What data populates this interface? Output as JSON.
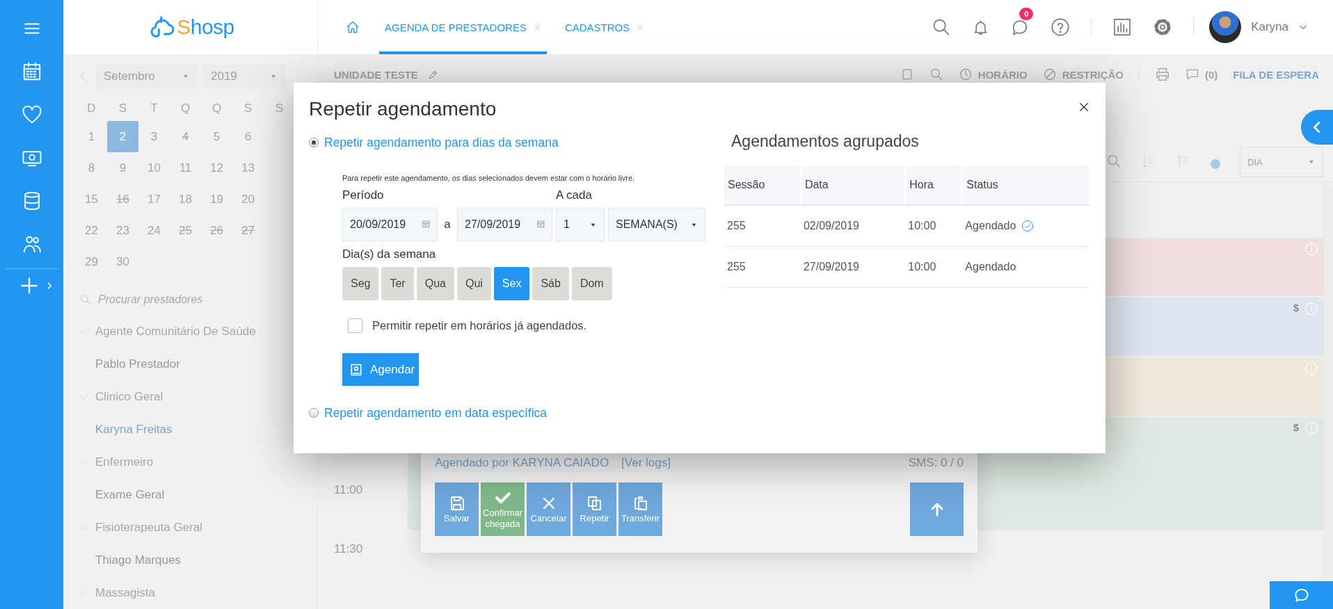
{
  "header": {
    "logo": [
      {
        "text": "S",
        "color": "#f5a623"
      },
      {
        "text": "hosp",
        "color": "#2196f3"
      }
    ],
    "tabs": [
      {
        "label": "AGENDA DE PRESTADORES",
        "selected": true
      },
      {
        "label": "CADASTROS",
        "selected": false
      }
    ],
    "chat_badge": "0",
    "user_name": "Karyna"
  },
  "calendar": {
    "month": "Setembro",
    "year": "2019",
    "weekdays": [
      "D",
      "S",
      "T",
      "Q",
      "Q",
      "S",
      "S"
    ],
    "weeks": [
      [
        {
          "day": "1",
          "struck": false,
          "selected": false
        },
        {
          "day": "2",
          "struck": false,
          "selected": true
        },
        {
          "day": "3",
          "struck": false,
          "selected": false
        },
        {
          "day": "4",
          "struck": true,
          "selected": false
        },
        {
          "day": "5",
          "struck": false,
          "selected": false
        },
        {
          "day": "6",
          "struck": false,
          "selected": false
        }
      ],
      [
        {
          "day": "8",
          "struck": false,
          "selected": false
        },
        {
          "day": "9",
          "struck": false,
          "selected": false
        },
        {
          "day": "10",
          "struck": false,
          "selected": false
        },
        {
          "day": "11",
          "struck": false,
          "selected": false
        },
        {
          "day": "12",
          "struck": false,
          "selected": false
        },
        {
          "day": "13",
          "struck": false,
          "selected": false
        }
      ],
      [
        {
          "day": "15",
          "struck": false,
          "selected": false
        },
        {
          "day": "16",
          "struck": true,
          "selected": false
        },
        {
          "day": "17",
          "struck": false,
          "selected": false
        },
        {
          "day": "18",
          "struck": false,
          "selected": false
        },
        {
          "day": "19",
          "struck": false,
          "selected": false
        },
        {
          "day": "20",
          "struck": false,
          "selected": false
        }
      ],
      [
        {
          "day": "22",
          "struck": false,
          "selected": false
        },
        {
          "day": "23",
          "struck": false,
          "selected": false
        },
        {
          "day": "24",
          "struck": false,
          "selected": false
        },
        {
          "day": "25",
          "struck": true,
          "selected": false
        },
        {
          "day": "26",
          "struck": true,
          "selected": false
        },
        {
          "day": "27",
          "struck": true,
          "selected": false
        }
      ],
      [
        {
          "day": "29",
          "struck": false,
          "selected": false
        },
        {
          "day": "30",
          "struck": false,
          "selected": false
        }
      ]
    ]
  },
  "provider_search": {
    "placeholder": "Procurar prestadores"
  },
  "providers": [
    {
      "label": "Agente Comunitário De Saúde",
      "expanded": true,
      "children": [
        {
          "label": "Pablo Prestador",
          "selected": false
        }
      ]
    },
    {
      "label": "Clinico Geral",
      "expanded": true,
      "children": [
        {
          "label": "Karyna Freitas",
          "selected": true
        }
      ]
    },
    {
      "label": "Enfermeiro",
      "expanded": true,
      "children": [
        {
          "label": "Exame Geral",
          "selected": false
        }
      ]
    },
    {
      "label": "Fisioterapeuta Geral",
      "expanded": true,
      "children": [
        {
          "label": "Thiago Marques",
          "selected": false
        }
      ]
    },
    {
      "label": "Massagista",
      "expanded": true
    }
  ],
  "schedule": {
    "unit": "UNIDADE TESTE",
    "toolbar": [
      {
        "kind": "clock",
        "label": "HORÁRIO"
      },
      {
        "kind": "restriction",
        "label": "RESTRIÇÃO"
      },
      {
        "kind": "comments",
        "label": "(0)"
      },
      {
        "kind": "link",
        "label": "FILA DE ESPERA"
      }
    ],
    "view": "DIA",
    "times": [
      "11:00",
      "11:30"
    ],
    "appointments": [
      {
        "color": "#f0dfdf"
      },
      {
        "color": "#dde6ef",
        "mark": "$"
      },
      {
        "color": "#efe8dc"
      },
      {
        "color": "#dfe8e2",
        "mark": "$"
      }
    ]
  },
  "popover": {
    "author": "Agendado por KARYNA CAIADO",
    "logs_link": "[Ver logs]",
    "sms": "SMS: 0 / 0",
    "actions": [
      {
        "kind": "save",
        "label": "Salvar"
      },
      {
        "kind": "confirm",
        "label": "Confirmar chegada"
      },
      {
        "kind": "cancel",
        "label": "Cancelar"
      },
      {
        "kind": "repeat",
        "label": "Repetir"
      },
      {
        "kind": "transfer",
        "label": "Transferir"
      }
    ]
  },
  "modal": {
    "title": "Repetir agendamento",
    "options": [
      {
        "label": "Repetir agendamento para dias da semana",
        "selected": true
      },
      {
        "label": "Repetir agendamento em data específica",
        "selected": false
      }
    ],
    "hint": "Para repetir este agendamento, os dias selecionados devem estar com o horário livre.",
    "period_label": "Período",
    "start_date": "20/09/2019",
    "between": "a",
    "end_date": "27/09/2019",
    "every_label": "A cada",
    "every_value": "1",
    "every_unit": "SEMANA(S)",
    "days_label": "Dia(s) da semana",
    "days": [
      {
        "label": "Seg",
        "selected": false
      },
      {
        "label": "Ter",
        "selected": false
      },
      {
        "label": "Qua",
        "selected": false
      },
      {
        "label": "Qui",
        "selected": false
      },
      {
        "label": "Sex",
        "selected": true
      },
      {
        "label": "Sáb",
        "selected": false
      },
      {
        "label": "Dom",
        "selected": false
      }
    ],
    "allow_booked": {
      "label": "Permitir repetir em horários já agendados.",
      "checked": false
    },
    "submit": "Agendar",
    "grouped": {
      "title": "Agendamentos agrupados",
      "columns": [
        "Sessão",
        "Data",
        "Hora",
        "Status"
      ],
      "rows": [
        {
          "session": "255",
          "date": "02/09/2019",
          "time": "10:00",
          "status": "Agendado",
          "confirmed": true
        },
        {
          "session": "255",
          "date": "27/09/2019",
          "time": "10:00",
          "status": "Agendado",
          "confirmed": false
        }
      ]
    }
  }
}
